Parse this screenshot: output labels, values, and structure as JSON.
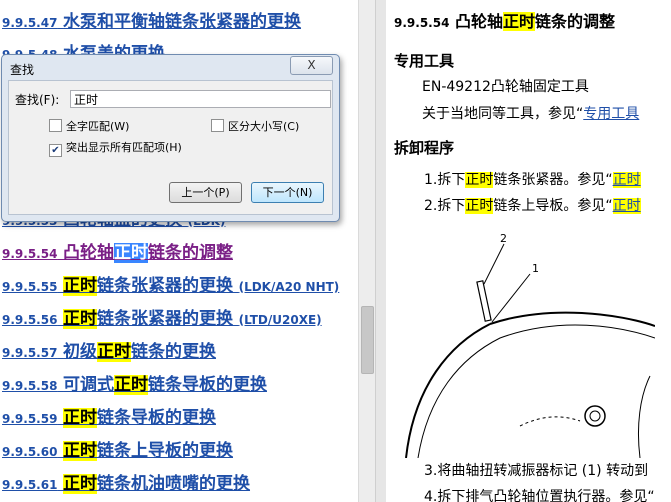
{
  "toc": [
    {
      "num": "9.9.5.47",
      "pre": "水泵和平衡轴链条张紧器的更换",
      "hl": "",
      "post": "",
      "sfx": "",
      "active": false,
      "partial": false
    },
    {
      "num": "9.9.5.48",
      "pre": "水泵盖的更换",
      "hl": "",
      "post": "",
      "sfx": "",
      "active": false,
      "partial": false
    },
    {
      "num": "9.9.5.53",
      "pre": "凸轮轴盖的更换",
      "hl": "",
      "post": "",
      "sfx": "(LDK)",
      "active": false,
      "partial": true
    },
    {
      "num": "9.9.5.54",
      "pre": "凸轮轴",
      "hl": "正时",
      "post": "链条的调整",
      "sfx": "",
      "active": true,
      "partial": false
    },
    {
      "num": "9.9.5.55",
      "pre": "",
      "hl": "正时",
      "post": "链条张紧器的更换",
      "sfx": "(LDK/A20 NHT)",
      "active": false,
      "partial": false
    },
    {
      "num": "9.9.5.56",
      "pre": "",
      "hl": "正时",
      "post": "链条张紧器的更换",
      "sfx": "(LTD/U20XE)",
      "active": false,
      "partial": false
    },
    {
      "num": "9.9.5.57",
      "pre": "初级",
      "hl": "正时",
      "post": "链条的更换",
      "sfx": "",
      "active": false,
      "partial": false
    },
    {
      "num": "9.9.5.58",
      "pre": "可调式",
      "hl": "正时",
      "post": "链条导板的更换",
      "sfx": "",
      "active": false,
      "partial": false
    },
    {
      "num": "9.9.5.59",
      "pre": "",
      "hl": "正时",
      "post": "链条导板的更换",
      "sfx": "",
      "active": false,
      "partial": false
    },
    {
      "num": "9.9.5.60",
      "pre": "",
      "hl": "正时",
      "post": "链条上导板的更换",
      "sfx": "",
      "active": false,
      "partial": false
    },
    {
      "num": "9.9.5.61",
      "pre": "",
      "hl": "正时",
      "post": "链条机油喷嘴的更换",
      "sfx": "",
      "active": false,
      "partial": false
    }
  ],
  "doc": {
    "num": "9.9.5.54",
    "title_pre": "凸轮轴",
    "title_hl": "正时",
    "title_post": "链条的调整",
    "special_tools_heading": "专用工具",
    "tool_line": "EN-49212凸轮轴固定工具",
    "equiv_pre": "关于当地同等工具，参见“",
    "equiv_link": "专用工具",
    "procedure_heading": "拆卸程序",
    "steps": [
      {
        "pre": "1.拆下",
        "hl": "正时",
        "post": "链条张紧器。参见“",
        "hl2": "正时"
      },
      {
        "pre": "2.拆下",
        "hl": "正时",
        "post": "链条上导板。参见“",
        "hl2": "正时"
      }
    ],
    "step3": "3.将曲轴扭转减振器标记 (1) 转动到",
    "step4": "4.拆下排气凸轮轴位置执行器。参见“",
    "figure_labels": [
      "2",
      "1"
    ]
  },
  "find": {
    "title": "查找",
    "close_label": "X",
    "label": "查找(F):",
    "value": "正时",
    "options": [
      {
        "label": "全字匹配(W)",
        "checked": false
      },
      {
        "label": "区分大小写(C)",
        "checked": false
      },
      {
        "label": "突出显示所有匹配项(H)",
        "checked": true
      }
    ],
    "prev_label": "上一个(P)",
    "next_label": "下一个(N)"
  }
}
